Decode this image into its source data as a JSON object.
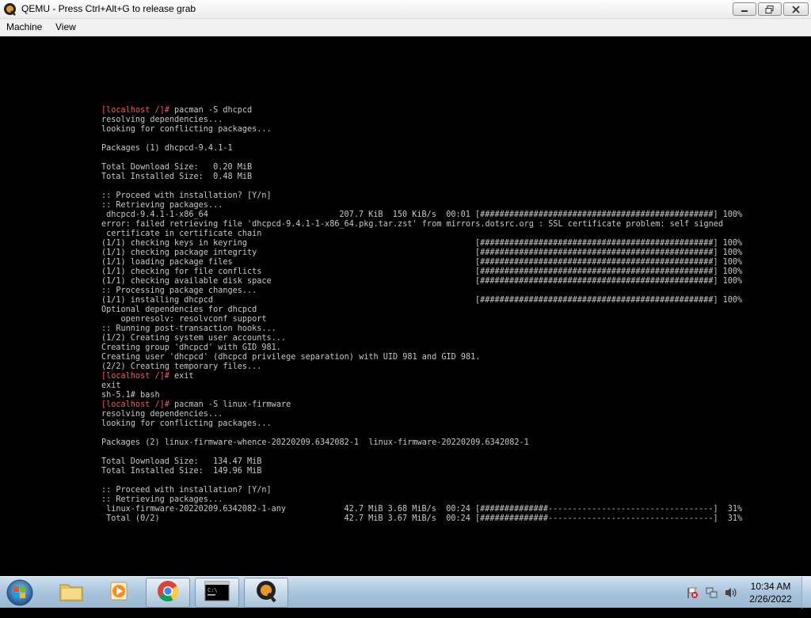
{
  "window": {
    "title": "QEMU - Press Ctrl+Alt+G to release grab",
    "app_icon": "qemu-icon",
    "controls": [
      "minimize-icon",
      "maximize-icon",
      "close-icon"
    ]
  },
  "menu": {
    "items": [
      {
        "label": "Machine"
      },
      {
        "label": "View"
      }
    ]
  },
  "terminal": {
    "text_color": "#c8c8c8",
    "prompt_color": "#ff5555",
    "lines": [
      {
        "prompt": "[localhost /]# ",
        "text": "pacman -S dhcpcd"
      },
      {
        "text": "resolving dependencies..."
      },
      {
        "text": "looking for conflicting packages..."
      },
      {
        "text": ""
      },
      {
        "text": "Packages (1) dhcpcd-9.4.1-1"
      },
      {
        "text": ""
      },
      {
        "text": "Total Download Size:   0.20 MiB"
      },
      {
        "text": "Total Installed Size:  0.48 MiB"
      },
      {
        "text": ""
      },
      {
        "text": ":: Proceed with installation? [Y/n]"
      },
      {
        "text": ":: Retrieving packages..."
      },
      {
        "text": " dhcpcd-9.4.1-1-x86_64",
        "size": "207.7 KiB",
        "rate": "150 KiB/s",
        "time": "00:01",
        "bar": "[################################################]",
        "pct": "100%"
      },
      {
        "text": "error: failed retrieving file 'dhcpcd-9.4.1-1-x86_64.pkg.tar.zst' from mirrors.dotsrc.org : SSL certificate problem: self signed"
      },
      {
        "text": " certificate in certificate chain"
      },
      {
        "text": "(1/1) checking keys in keyring",
        "bar": "[################################################]",
        "pct": "100%"
      },
      {
        "text": "(1/1) checking package integrity",
        "bar": "[################################################]",
        "pct": "100%"
      },
      {
        "text": "(1/1) loading package files",
        "bar": "[################################################]",
        "pct": "100%"
      },
      {
        "text": "(1/1) checking for file conflicts",
        "bar": "[################################################]",
        "pct": "100%"
      },
      {
        "text": "(1/1) checking available disk space",
        "bar": "[################################################]",
        "pct": "100%"
      },
      {
        "text": ":: Processing package changes..."
      },
      {
        "text": "(1/1) installing dhcpcd",
        "bar": "[################################################]",
        "pct": "100%"
      },
      {
        "text": "Optional dependencies for dhcpcd"
      },
      {
        "text": "    openresolv: resolvconf support"
      },
      {
        "text": ":: Running post-transaction hooks..."
      },
      {
        "text": "(1/2) Creating system user accounts..."
      },
      {
        "text": "Creating group 'dhcpcd' with GID 981."
      },
      {
        "text": "Creating user 'dhcpcd' (dhcpcd privilege separation) with UID 981 and GID 981."
      },
      {
        "text": "(2/2) Creating temporary files..."
      },
      {
        "prompt": "[localhost /]# ",
        "text": "exit"
      },
      {
        "text": "exit"
      },
      {
        "text": "sh-5.1# bash"
      },
      {
        "prompt": "[localhost /]# ",
        "text": "pacman -S linux-firmware"
      },
      {
        "text": "resolving dependencies..."
      },
      {
        "text": "looking for conflicting packages..."
      },
      {
        "text": ""
      },
      {
        "text": "Packages (2) linux-firmware-whence-20220209.6342082-1  linux-firmware-20220209.6342082-1"
      },
      {
        "text": ""
      },
      {
        "text": "Total Download Size:   134.47 MiB"
      },
      {
        "text": "Total Installed Size:  149.96 MiB"
      },
      {
        "text": ""
      },
      {
        "text": ":: Proceed with installation? [Y/n]"
      },
      {
        "text": ":: Retrieving packages..."
      },
      {
        "text": " linux-firmware-20220209.6342082-1-any",
        "size": "42.7 MiB",
        "rate": "3.68 MiB/s",
        "time": "00:24",
        "bar": "[##############----------------------------------]",
        "pct": "31%"
      },
      {
        "text": " Total (0/2)",
        "size": "42.7 MiB",
        "rate": "3.67 MiB/s",
        "time": "00:24",
        "bar": "[##############----------------------------------]",
        "pct": "31%"
      }
    ]
  },
  "taskbar": {
    "buttons": [
      {
        "name": "start-button",
        "icon": "windows-logo-icon"
      },
      {
        "name": "taskbar-explorer",
        "icon": "folder-icon"
      },
      {
        "name": "taskbar-media-player",
        "icon": "media-player-icon"
      },
      {
        "name": "taskbar-chrome",
        "icon": "chrome-icon"
      },
      {
        "name": "taskbar-cmd",
        "icon": "command-prompt-icon"
      },
      {
        "name": "taskbar-qemu",
        "icon": "qemu-icon"
      }
    ],
    "tray_icons": [
      "action-center-flag-icon",
      "network-icon",
      "volume-icon"
    ],
    "clock_time": "10:34 AM",
    "clock_date": "2/26/2022"
  }
}
